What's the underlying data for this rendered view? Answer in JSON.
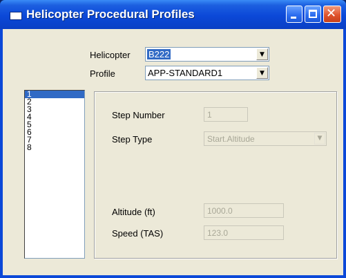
{
  "window": {
    "title": "Helicopter Procedural Profiles",
    "controls": {
      "minimize": "minimize",
      "maximize": "maximize",
      "close": "✕"
    }
  },
  "form": {
    "helicopter_label": "Helicopter",
    "helicopter_value": "B222",
    "profile_label": "Profile",
    "profile_value": "APP-STANDARD1"
  },
  "steps": {
    "items": [
      "1",
      "2",
      "3",
      "4",
      "5",
      "6",
      "7",
      "8"
    ],
    "selected": "1"
  },
  "details": {
    "step_number_label": "Step Number",
    "step_number_value": "1",
    "step_type_label": "Step Type",
    "step_type_value": "Start.Altitude",
    "altitude_label": "Altitude (ft)",
    "altitude_value": "1000.0",
    "speed_label": "Speed (TAS)",
    "speed_value": "123.0"
  },
  "colors": {
    "titlebar": "#0b48d8",
    "selection": "#316ac5",
    "dialog_background": "#ece9d8"
  }
}
